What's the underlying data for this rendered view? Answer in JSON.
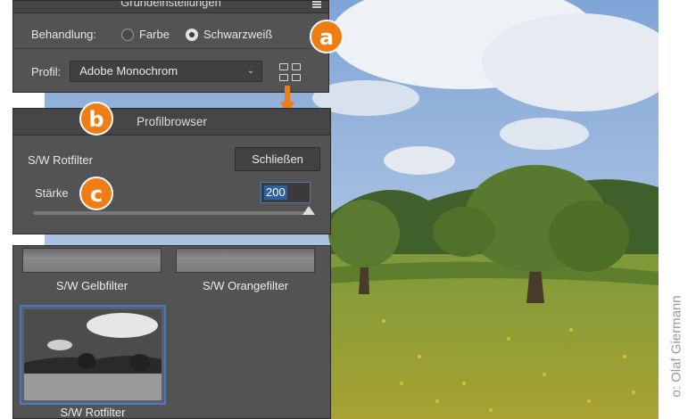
{
  "credit": "o: Olaf Giermann",
  "panel_basic": {
    "title": "Grundeinstellungen",
    "treatment_label": "Behandlung:",
    "option_color": "Farbe",
    "option_bw": "Schwarzweiß",
    "selected": "Schwarzweiß",
    "profile_label": "Profil:",
    "profile_value": "Adobe Monochrom"
  },
  "panel_browser": {
    "title": "Profilbrowser",
    "filter_name": "S/W Rotfilter",
    "close_button": "Schließen",
    "amount_label": "Stärke",
    "amount_value": "200",
    "amount_slider_fraction": 1.0
  },
  "profile_list": {
    "items": [
      {
        "label": "S/W Gelbfilter"
      },
      {
        "label": "S/W Orangefilter"
      },
      {
        "label": "S/W Rotfilter",
        "selected": true
      }
    ]
  },
  "badges": [
    "a",
    "b",
    "c"
  ],
  "colors": {
    "accent_orange": "#ef7d14",
    "panel_bg": "#535353",
    "selection_blue": "#4d78c2"
  }
}
